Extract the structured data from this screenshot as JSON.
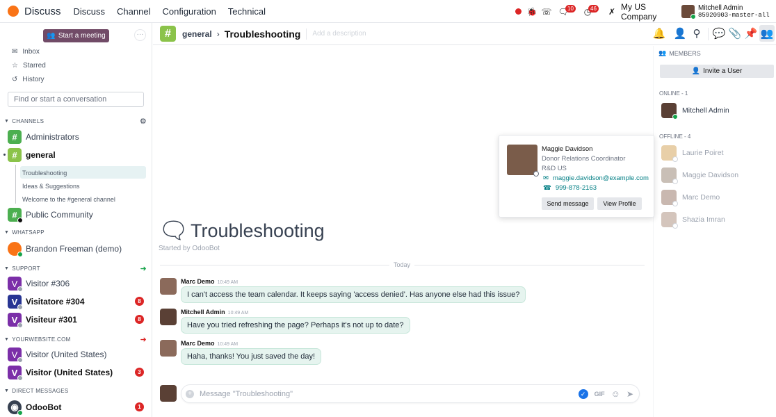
{
  "topbar": {
    "app_name": "Discuss",
    "menu": [
      "Discuss",
      "Channel",
      "Configuration",
      "Technical"
    ],
    "messages_badge": "10",
    "activity_badge": "46",
    "company": "My US Company",
    "user_name": "Mitchell Admin",
    "db_name": "85920903-master-all"
  },
  "sidebar": {
    "start_meeting": "Start a meeting",
    "nav": [
      "Inbox",
      "Starred",
      "History"
    ],
    "search_placeholder": "Find or start a conversation",
    "channels_title": "CHANNELS",
    "channels": [
      {
        "name": "Administrators"
      },
      {
        "name": "general"
      },
      {
        "name": "Public Community"
      }
    ],
    "subchannels": [
      "Troubleshooting",
      "Ideas & Suggestions",
      "Welcome to the #general channel"
    ],
    "whatsapp_title": "WHATSAPP",
    "whatsapp": [
      {
        "name": "Brandon Freeman (demo)"
      }
    ],
    "support_title": "SUPPORT",
    "support": [
      {
        "name": "Visitor #306",
        "count": ""
      },
      {
        "name": "Visitatore #304",
        "count": "8"
      },
      {
        "name": "Visiteur #301",
        "count": "8"
      }
    ],
    "website_title": "YOURWEBSITE.COM",
    "website": [
      {
        "name": "Visitor (United States)",
        "count": ""
      },
      {
        "name": "Visitor (United States)",
        "count": "3"
      }
    ],
    "dm_title": "DIRECT MESSAGES",
    "dm": [
      {
        "name": "OdooBot",
        "count": "1"
      }
    ]
  },
  "header": {
    "parent": "general",
    "thread": "Troubleshooting",
    "description_placeholder": "Add a description"
  },
  "chat": {
    "title": "Troubleshooting",
    "started_by": "Started by OdooBot",
    "day": "Today",
    "messages": [
      {
        "author": "Marc Demo",
        "time": "10:49 AM",
        "text": "I can't access the team calendar. It keeps saying 'access denied'. Has anyone else had this issue?"
      },
      {
        "author": "Mitchell Admin",
        "time": "10:49 AM",
        "text": "Have you tried refreshing the page? Perhaps it's not up to date?"
      },
      {
        "author": "Marc Demo",
        "time": "10:49 AM",
        "text": "Haha, thanks! You just saved the day!"
      }
    ],
    "composer_placeholder": "Message \"Troubleshooting\"",
    "gif": "GIF"
  },
  "members": {
    "title": "MEMBERS",
    "invite": "Invite a User",
    "online_title": "ONLINE - 1",
    "online": [
      "Mitchell Admin"
    ],
    "offline_title": "OFFLINE - 4",
    "offline": [
      "Laurie Poiret",
      "Maggie Davidson",
      "Marc Demo",
      "Shazia Imran"
    ]
  },
  "popover": {
    "name": "Maggie Davidson",
    "job": "Donor Relations Coordinator",
    "company": "R&D US",
    "email": "maggie.davidson@example.com",
    "phone": "999-878-2163",
    "send": "Send message",
    "view": "View Profile"
  },
  "colors": {
    "accent": "#714b67",
    "channel_green": "#4caf50",
    "bubble": "#e6f4ef",
    "badge": "#dc2626",
    "link": "#017e84"
  }
}
